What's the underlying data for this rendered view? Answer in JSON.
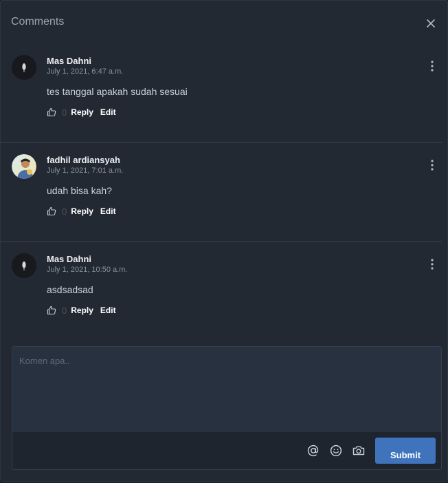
{
  "header": {
    "title": "Comments"
  },
  "comments": [
    {
      "author": "Mas Dahni",
      "timestamp": "July 1, 2021, 6:47 a.m.",
      "text": "tes tanggal apakah sudah sesuai",
      "likes": "0",
      "reply_label": "Reply",
      "edit_label": "Edit"
    },
    {
      "author": "fadhil ardiansyah",
      "timestamp": "July 1, 2021, 7:01 a.m.",
      "text": "udah bisa kah?",
      "likes": "0",
      "reply_label": "Reply",
      "edit_label": "Edit"
    },
    {
      "author": "Mas Dahni",
      "timestamp": "July 1, 2021, 10:50 a.m.",
      "text": "asdsadsad",
      "likes": "0",
      "reply_label": "Reply",
      "edit_label": "Edit"
    }
  ],
  "composer": {
    "placeholder": "Komen apa..",
    "value": "",
    "submit_label": "Submit"
  },
  "icons": {
    "close": "close-icon",
    "more": "more-vertical-icon",
    "like": "thumbs-up-icon",
    "mention": "at-sign-icon",
    "emoji": "smile-icon",
    "camera": "camera-icon"
  },
  "colors": {
    "background": "#222933",
    "accent": "#3f74bd",
    "text_primary": "#eef0f3",
    "text_muted": "#8b949e"
  }
}
